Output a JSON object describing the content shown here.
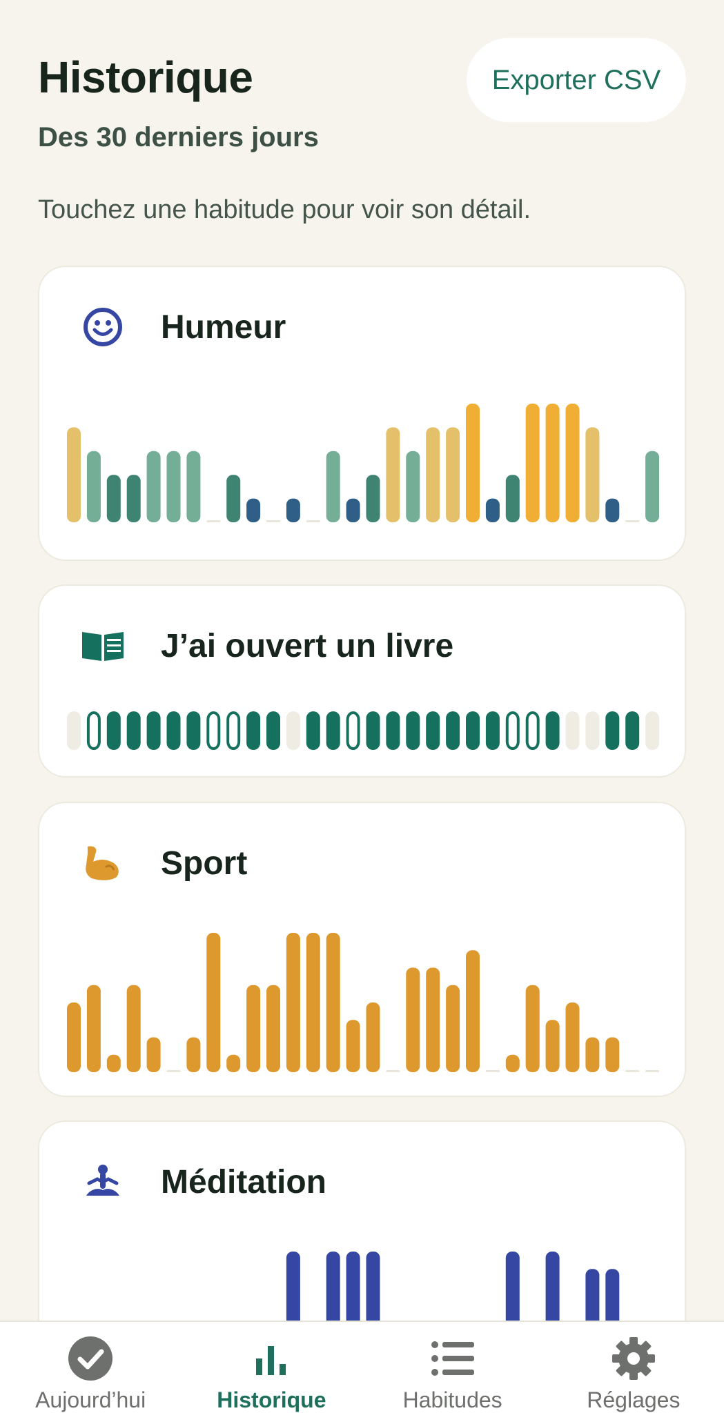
{
  "header": {
    "title": "Historique",
    "subtitle": "Des 30 derniers jours",
    "export_label": "Exporter CSV",
    "hint": "Touchez une habitude pour voir son détail."
  },
  "colors": {
    "accent": "#1e6f5c",
    "mood_1": "#2f5e87",
    "mood_2": "#3f8472",
    "mood_3": "#74ae96",
    "mood_4": "#e3c069",
    "mood_5": "#f0ae35",
    "book_done": "#15705d",
    "sport": "#dd982e",
    "meditation": "#3647a3",
    "empty": "#efece4"
  },
  "cards": {
    "mood": {
      "title": "Humeur",
      "icon": "smiley-icon"
    },
    "book": {
      "title": "J’ai ouvert un livre",
      "icon": "open-book-icon"
    },
    "sport": {
      "title": "Sport",
      "icon": "flexed-arm-icon"
    },
    "meditation": {
      "title": "Méditation",
      "icon": "meditation-icon"
    }
  },
  "nav": {
    "items": [
      {
        "label": "Aujourd’hui",
        "icon": "check-circle-icon",
        "active": false
      },
      {
        "label": "Historique",
        "icon": "bar-chart-icon",
        "active": true
      },
      {
        "label": "Habitudes",
        "icon": "list-icon",
        "active": false
      },
      {
        "label": "Réglages",
        "icon": "gear-icon",
        "active": false
      }
    ]
  },
  "chart_data": [
    {
      "id": "mood",
      "type": "bar",
      "title": "Humeur",
      "days": 30,
      "ylim": [
        0,
        5
      ],
      "values": [
        4,
        3,
        2,
        2,
        3,
        3,
        3,
        0,
        2,
        1,
        0,
        1,
        0,
        3,
        1,
        2,
        4,
        3,
        4,
        4,
        5,
        1,
        2,
        5,
        5,
        5,
        4,
        1,
        0,
        3
      ]
    },
    {
      "id": "book",
      "type": "heatmap",
      "title": "J’ai ouvert un livre",
      "days": 30,
      "states": [
        "empty",
        "outline",
        "done",
        "done",
        "done",
        "done",
        "done",
        "outline",
        "outline",
        "done",
        "done",
        "empty",
        "done",
        "done",
        "outline",
        "done",
        "done",
        "done",
        "done",
        "done",
        "done",
        "done",
        "outline",
        "outline",
        "done",
        "empty",
        "empty",
        "done",
        "done",
        "empty",
        "empty"
      ]
    },
    {
      "id": "sport",
      "type": "bar",
      "title": "Sport",
      "days": 30,
      "ylim": [
        0,
        8
      ],
      "values": [
        4,
        5,
        1,
        5,
        2,
        0,
        2,
        8,
        1,
        5,
        5,
        8,
        8,
        8,
        3,
        4,
        0,
        6,
        6,
        5,
        7,
        0,
        1,
        5,
        3,
        4,
        2,
        2,
        0,
        0
      ]
    },
    {
      "id": "meditation",
      "type": "bar",
      "title": "Méditation",
      "days": 30,
      "ylim": [
        0,
        8
      ],
      "values": [
        0,
        0,
        0,
        0,
        0,
        0,
        0,
        0,
        0,
        0,
        0,
        8,
        0,
        10,
        10,
        8,
        0,
        0,
        0,
        0,
        0,
        0,
        10,
        0,
        8,
        0,
        7,
        7,
        0,
        0
      ]
    }
  ]
}
